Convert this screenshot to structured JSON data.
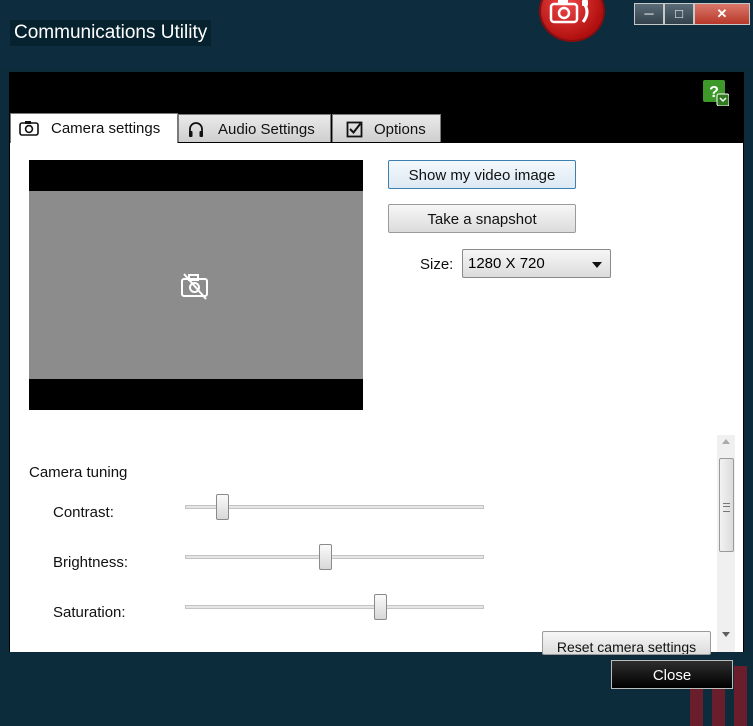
{
  "window": {
    "title": "Communications Utility",
    "app_icon": "camera-phone-icon",
    "controls": {
      "minimize": "─",
      "maximize": "□",
      "close": "✕"
    }
  },
  "help": {
    "icon": "help-question-icon"
  },
  "tabs": [
    {
      "label": "Camera settings",
      "icon": "camera-icon",
      "active": true
    },
    {
      "label": "Audio Settings",
      "icon": "headset-icon",
      "active": false
    },
    {
      "label": "Options",
      "icon": "checkbox-icon",
      "active": false
    }
  ],
  "camera": {
    "preview_icon": "camera-off-icon",
    "show_video_label": "Show my video image",
    "snapshot_label": "Take a snapshot",
    "size_label": "Size:",
    "size_value": "1280 X 720"
  },
  "tuning": {
    "title": "Camera tuning",
    "sliders": [
      {
        "label": "Contrast:",
        "level": 0.11
      },
      {
        "label": "Brightness:",
        "level": 0.47
      },
      {
        "label": "Saturation:",
        "level": 0.66
      }
    ],
    "reset_label": "Reset camera settings"
  },
  "footer": {
    "close_label": "Close"
  },
  "colors": {
    "background": "#0c2c3c",
    "accent": "#3c7fb1",
    "app_icon": "#c41414"
  }
}
